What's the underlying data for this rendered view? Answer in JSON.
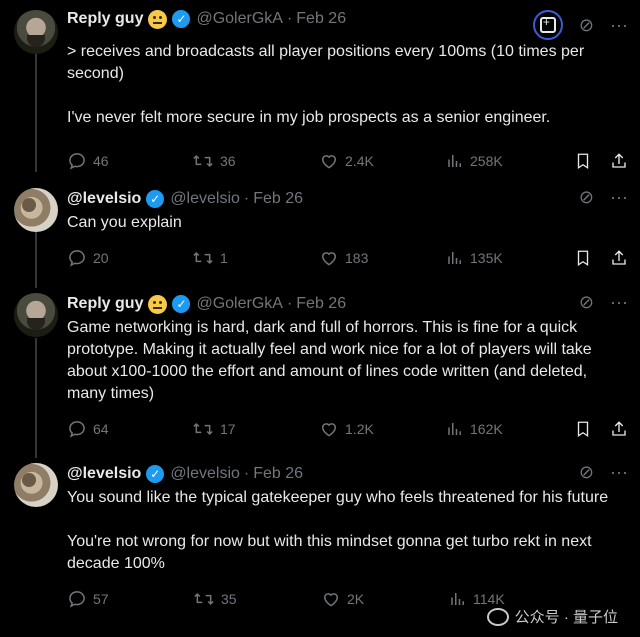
{
  "posts": [
    {
      "name": "Reply guy",
      "emoji": "neutral-face",
      "verified": true,
      "handle": "@GolerGkA",
      "date": "Feb 26",
      "lines": [
        "> receives and broadcasts all player positions every 100ms (10 times per second)",
        "",
        "I've never felt more secure in my job prospects as a senior engineer."
      ],
      "replies": "46",
      "reposts": "36",
      "likes": "2.4K",
      "views": "258K"
    },
    {
      "name": "@levelsio",
      "verified": true,
      "handle": "@levelsio",
      "date": "Feb 26",
      "lines": [
        "Can you explain"
      ],
      "replies": "20",
      "reposts": "1",
      "likes": "183",
      "views": "135K"
    },
    {
      "name": "Reply guy",
      "emoji": "neutral-face",
      "verified": true,
      "handle": "@GolerGkA",
      "date": "Feb 26",
      "lines": [
        "Game networking is hard, dark and full of horrors. This is fine for a quick prototype. Making it actually feel and work nice for a lot of players will take about x100-1000 the effort and amount of lines code written (and deleted, many times)"
      ],
      "replies": "64",
      "reposts": "17",
      "likes": "1.2K",
      "views": "162K"
    },
    {
      "name": "@levelsio",
      "verified": true,
      "handle": "@levelsio",
      "date": "Feb 26",
      "lines": [
        "You sound like the typical gatekeeper guy who feels threatened for his future",
        "",
        "You're not wrong for now but with this mindset gonna get turbo rekt in next decade 100%"
      ],
      "replies": "57",
      "reposts": "35",
      "likes": "2K",
      "views": "114K"
    }
  ],
  "separator": "·",
  "watermark": "公众号 · 量子位",
  "colors": {
    "background": "#000000",
    "text": "#e7e9ea",
    "muted": "#71767b",
    "verified": "#1d9bf0",
    "emoji": "#f7c948"
  }
}
